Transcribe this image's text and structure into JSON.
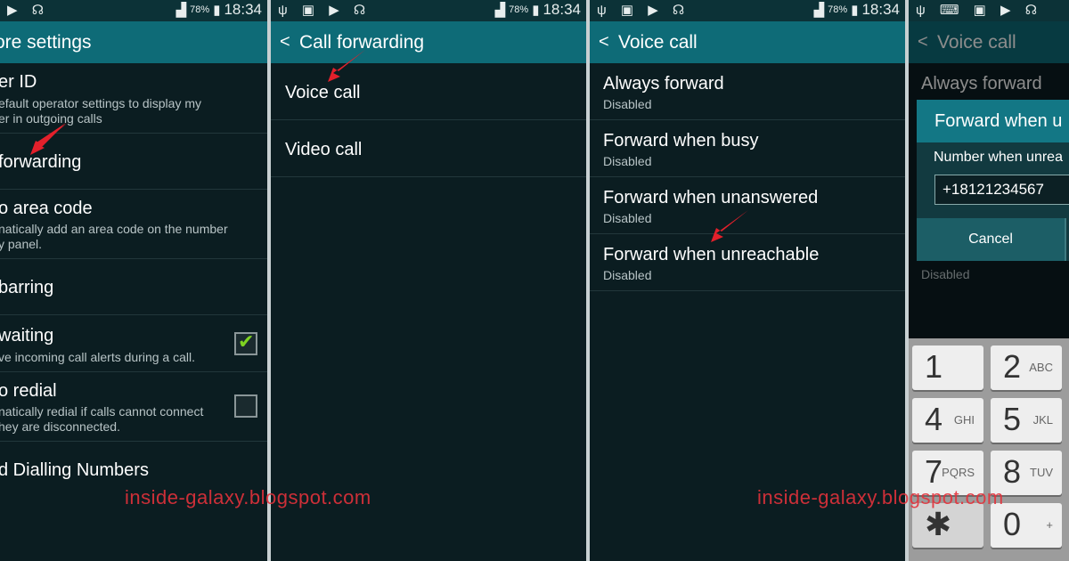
{
  "status": {
    "battery": "78%",
    "time": "18:34"
  },
  "panel1": {
    "title": "ore settings",
    "items": [
      {
        "title": "er ID",
        "sub": [
          "efault operator settings to display my",
          "er in outgoing calls"
        ]
      },
      {
        "title": "forwarding"
      },
      {
        "title": "o area code",
        "sub": [
          "natically add an area code on the number",
          "y panel."
        ]
      },
      {
        "title": "barring"
      },
      {
        "title": "waiting",
        "sub": [
          "ve incoming call alerts during a call."
        ],
        "checked": true
      },
      {
        "title": "o redial",
        "sub": [
          "natically redial if calls cannot connect",
          "hey are disconnected."
        ],
        "checked": false
      },
      {
        "title": "d Dialling Numbers"
      }
    ]
  },
  "panel2": {
    "title": "Call forwarding",
    "items": [
      "Voice call",
      "Video call"
    ]
  },
  "panel3": {
    "title": "Voice call",
    "items": [
      {
        "title": "Always forward",
        "sub": "Disabled"
      },
      {
        "title": "Forward when busy",
        "sub": "Disabled"
      },
      {
        "title": "Forward when unanswered",
        "sub": "Disabled"
      },
      {
        "title": "Forward when unreachable",
        "sub": "Disabled"
      }
    ]
  },
  "panel4": {
    "title": "Voice call",
    "behind_item": "Always forward",
    "behind_sub": "Disabled",
    "dialog": {
      "title": "Forward when u",
      "label": "Number when unrea",
      "value": "+18121234567",
      "cancel": "Cancel"
    },
    "keypad": [
      {
        "d": "1",
        "l": ""
      },
      {
        "d": "2",
        "l": "ABC"
      },
      {
        "d": "4",
        "l": "GHI"
      },
      {
        "d": "5",
        "l": "JKL"
      },
      {
        "d": "7",
        "l": "PQRS"
      },
      {
        "d": "8",
        "l": "TUV"
      },
      {
        "d": "✱",
        "l": ""
      },
      {
        "d": "0",
        "l": "+"
      }
    ]
  },
  "watermark": "inside-galaxy.blogspot.com",
  "colors": {
    "header": "#0e6b77",
    "background": "#0b1d21",
    "arrow": "#e3202b",
    "watermark": "#e3323b"
  }
}
